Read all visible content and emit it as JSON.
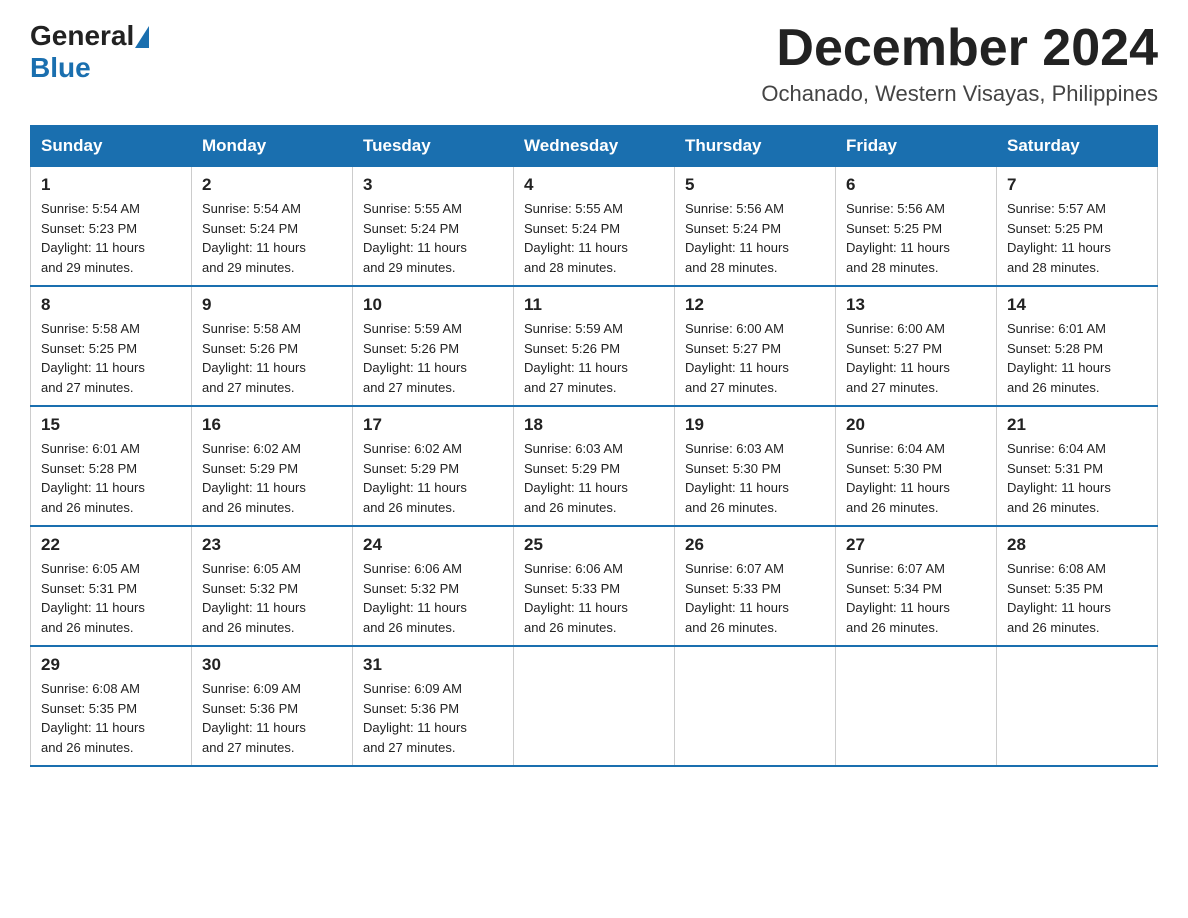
{
  "header": {
    "logo_general": "General",
    "logo_blue": "Blue",
    "month_year": "December 2024",
    "location": "Ochanado, Western Visayas, Philippines"
  },
  "days_of_week": [
    "Sunday",
    "Monday",
    "Tuesday",
    "Wednesday",
    "Thursday",
    "Friday",
    "Saturday"
  ],
  "weeks": [
    [
      {
        "day": "1",
        "sunrise": "5:54 AM",
        "sunset": "5:23 PM",
        "daylight": "11 hours and 29 minutes."
      },
      {
        "day": "2",
        "sunrise": "5:54 AM",
        "sunset": "5:24 PM",
        "daylight": "11 hours and 29 minutes."
      },
      {
        "day": "3",
        "sunrise": "5:55 AM",
        "sunset": "5:24 PM",
        "daylight": "11 hours and 29 minutes."
      },
      {
        "day": "4",
        "sunrise": "5:55 AM",
        "sunset": "5:24 PM",
        "daylight": "11 hours and 28 minutes."
      },
      {
        "day": "5",
        "sunrise": "5:56 AM",
        "sunset": "5:24 PM",
        "daylight": "11 hours and 28 minutes."
      },
      {
        "day": "6",
        "sunrise": "5:56 AM",
        "sunset": "5:25 PM",
        "daylight": "11 hours and 28 minutes."
      },
      {
        "day": "7",
        "sunrise": "5:57 AM",
        "sunset": "5:25 PM",
        "daylight": "11 hours and 28 minutes."
      }
    ],
    [
      {
        "day": "8",
        "sunrise": "5:58 AM",
        "sunset": "5:25 PM",
        "daylight": "11 hours and 27 minutes."
      },
      {
        "day": "9",
        "sunrise": "5:58 AM",
        "sunset": "5:26 PM",
        "daylight": "11 hours and 27 minutes."
      },
      {
        "day": "10",
        "sunrise": "5:59 AM",
        "sunset": "5:26 PM",
        "daylight": "11 hours and 27 minutes."
      },
      {
        "day": "11",
        "sunrise": "5:59 AM",
        "sunset": "5:26 PM",
        "daylight": "11 hours and 27 minutes."
      },
      {
        "day": "12",
        "sunrise": "6:00 AM",
        "sunset": "5:27 PM",
        "daylight": "11 hours and 27 minutes."
      },
      {
        "day": "13",
        "sunrise": "6:00 AM",
        "sunset": "5:27 PM",
        "daylight": "11 hours and 27 minutes."
      },
      {
        "day": "14",
        "sunrise": "6:01 AM",
        "sunset": "5:28 PM",
        "daylight": "11 hours and 26 minutes."
      }
    ],
    [
      {
        "day": "15",
        "sunrise": "6:01 AM",
        "sunset": "5:28 PM",
        "daylight": "11 hours and 26 minutes."
      },
      {
        "day": "16",
        "sunrise": "6:02 AM",
        "sunset": "5:29 PM",
        "daylight": "11 hours and 26 minutes."
      },
      {
        "day": "17",
        "sunrise": "6:02 AM",
        "sunset": "5:29 PM",
        "daylight": "11 hours and 26 minutes."
      },
      {
        "day": "18",
        "sunrise": "6:03 AM",
        "sunset": "5:29 PM",
        "daylight": "11 hours and 26 minutes."
      },
      {
        "day": "19",
        "sunrise": "6:03 AM",
        "sunset": "5:30 PM",
        "daylight": "11 hours and 26 minutes."
      },
      {
        "day": "20",
        "sunrise": "6:04 AM",
        "sunset": "5:30 PM",
        "daylight": "11 hours and 26 minutes."
      },
      {
        "day": "21",
        "sunrise": "6:04 AM",
        "sunset": "5:31 PM",
        "daylight": "11 hours and 26 minutes."
      }
    ],
    [
      {
        "day": "22",
        "sunrise": "6:05 AM",
        "sunset": "5:31 PM",
        "daylight": "11 hours and 26 minutes."
      },
      {
        "day": "23",
        "sunrise": "6:05 AM",
        "sunset": "5:32 PM",
        "daylight": "11 hours and 26 minutes."
      },
      {
        "day": "24",
        "sunrise": "6:06 AM",
        "sunset": "5:32 PM",
        "daylight": "11 hours and 26 minutes."
      },
      {
        "day": "25",
        "sunrise": "6:06 AM",
        "sunset": "5:33 PM",
        "daylight": "11 hours and 26 minutes."
      },
      {
        "day": "26",
        "sunrise": "6:07 AM",
        "sunset": "5:33 PM",
        "daylight": "11 hours and 26 minutes."
      },
      {
        "day": "27",
        "sunrise": "6:07 AM",
        "sunset": "5:34 PM",
        "daylight": "11 hours and 26 minutes."
      },
      {
        "day": "28",
        "sunrise": "6:08 AM",
        "sunset": "5:35 PM",
        "daylight": "11 hours and 26 minutes."
      }
    ],
    [
      {
        "day": "29",
        "sunrise": "6:08 AM",
        "sunset": "5:35 PM",
        "daylight": "11 hours and 26 minutes."
      },
      {
        "day": "30",
        "sunrise": "6:09 AM",
        "sunset": "5:36 PM",
        "daylight": "11 hours and 27 minutes."
      },
      {
        "day": "31",
        "sunrise": "6:09 AM",
        "sunset": "5:36 PM",
        "daylight": "11 hours and 27 minutes."
      },
      null,
      null,
      null,
      null
    ]
  ],
  "labels": {
    "sunrise": "Sunrise:",
    "sunset": "Sunset:",
    "daylight": "Daylight:"
  }
}
